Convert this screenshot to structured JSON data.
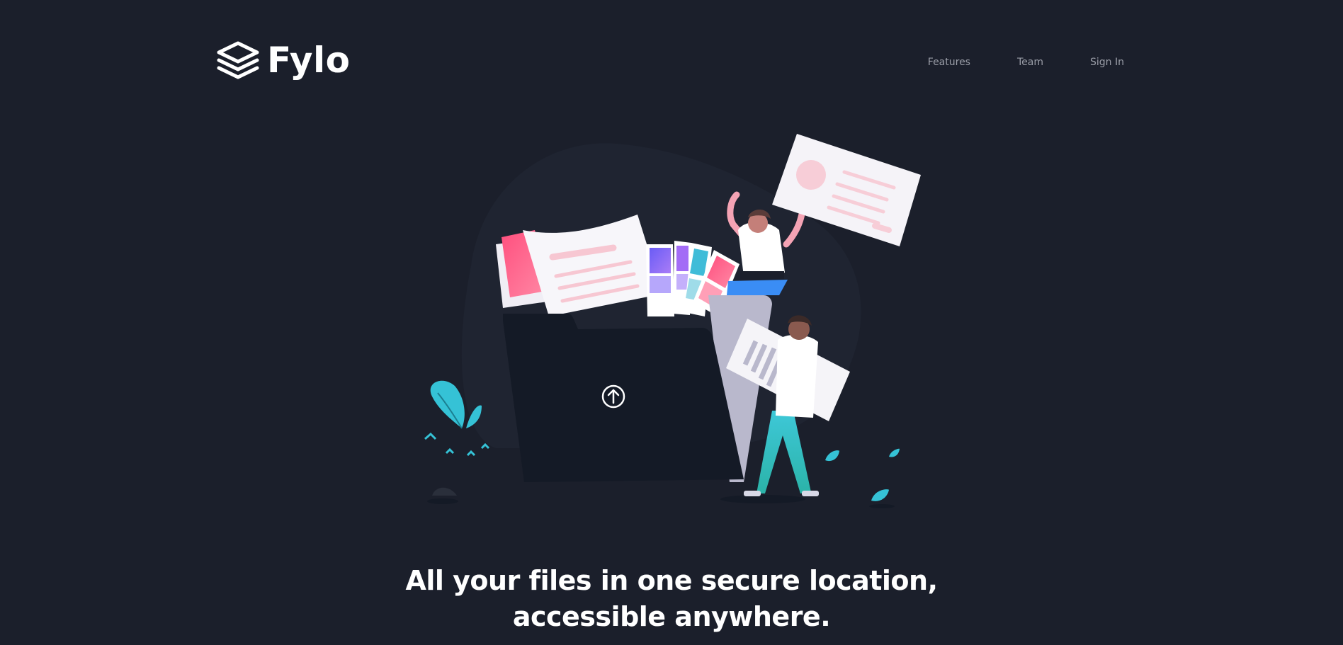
{
  "brand": {
    "name": "Fylo",
    "logo_icon": "stacked-layers-icon"
  },
  "nav": {
    "items": [
      {
        "label": "Features"
      },
      {
        "label": "Team"
      },
      {
        "label": "Sign In"
      }
    ]
  },
  "hero": {
    "title_line1": "All your files in one secure location,",
    "title_line2": "accessible anywhere.",
    "illustration": "people-with-files-illustration",
    "upload_icon": "upload-arrow-icon"
  },
  "colors": {
    "background": "#1b1f2b",
    "folder": "#141a26",
    "accent_teal": "#37c3d6",
    "accent_pink": "#fa5e8a",
    "accent_purple": "#7a5cf5",
    "text": "#ffffff"
  }
}
